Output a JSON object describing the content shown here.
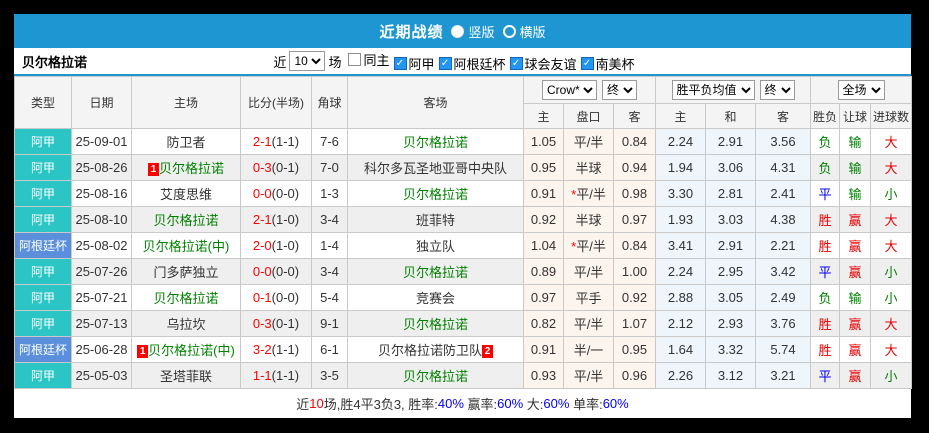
{
  "colors": {
    "accent": "#1e96d2",
    "league_cyan": "#2cc5c5",
    "league_blue": "#5a8fdc",
    "win": "#e60000",
    "loss": "#008000",
    "draw": "#0000f0",
    "score": "#ff0000",
    "team_green": "#008000",
    "link_blue": "#0000f0"
  },
  "title_bar": {
    "title": "近期战绩",
    "layout_options": [
      {
        "label": "竖版",
        "selected": true
      },
      {
        "label": "横版",
        "selected": false
      }
    ]
  },
  "filter_bar": {
    "team": "贝尔格拉诺",
    "near_label": "近",
    "matches_value": "10",
    "matches_label": "场",
    "checkboxes": [
      {
        "label": "同主",
        "checked": false
      },
      {
        "label": "阿甲",
        "checked": true
      },
      {
        "label": "阿根廷杯",
        "checked": true
      },
      {
        "label": "球会友谊",
        "checked": true
      },
      {
        "label": "南美杯",
        "checked": true
      }
    ]
  },
  "table": {
    "columns": [
      "类型",
      "日期",
      "主场",
      "比分(半场)",
      "角球",
      "客场"
    ],
    "odds_group": {
      "book_select": "Crow*",
      "period_select": "终"
    },
    "mean_group": {
      "label_select": "胜平负均值",
      "period_select": "终"
    },
    "scope_group": {
      "label_select": "全场"
    },
    "sub_columns": [
      "主",
      "盘口",
      "客",
      "主",
      "和",
      "客",
      "胜负",
      "让球",
      "进球数"
    ],
    "rows": [
      {
        "type": "阿甲",
        "type_color": "cyan",
        "date": "25-09-01",
        "home": {
          "text": "防卫者",
          "green": false,
          "badge": null
        },
        "score": {
          "main": "2-1",
          "half": "(1-1)"
        },
        "corner": "7-6",
        "away": {
          "text": "贝尔格拉诺",
          "green": true,
          "badge": null
        },
        "odds": {
          "home": "1.05",
          "handicap": "平/半",
          "star": false,
          "away": "0.84"
        },
        "means": [
          "2.24",
          "2.91",
          "3.56"
        ],
        "results": [
          {
            "t": "负",
            "c": "g"
          },
          {
            "t": "输",
            "c": "g"
          },
          {
            "t": "大",
            "c": "r"
          }
        ]
      },
      {
        "type": "阿甲",
        "type_color": "cyan",
        "date": "25-08-26",
        "home": {
          "text": "贝尔格拉诺",
          "green": true,
          "badge": "1"
        },
        "score": {
          "main": "0-3",
          "half": "(0-1)"
        },
        "corner": "7-0",
        "away": {
          "text": "科尔多瓦圣地亚哥中央队",
          "green": false,
          "badge": null
        },
        "odds": {
          "home": "0.95",
          "handicap": "半球",
          "star": false,
          "away": "0.94"
        },
        "means": [
          "1.94",
          "3.06",
          "4.31"
        ],
        "results": [
          {
            "t": "负",
            "c": "g"
          },
          {
            "t": "输",
            "c": "g"
          },
          {
            "t": "大",
            "c": "r"
          }
        ]
      },
      {
        "type": "阿甲",
        "type_color": "cyan",
        "date": "25-08-16",
        "home": {
          "text": "艾度思维",
          "green": false,
          "badge": null
        },
        "score": {
          "main": "0-0",
          "half": "(0-0)"
        },
        "corner": "1-3",
        "away": {
          "text": "贝尔格拉诺",
          "green": true,
          "badge": null
        },
        "odds": {
          "home": "0.91",
          "handicap": "平/半",
          "star": true,
          "away": "0.98"
        },
        "means": [
          "3.30",
          "2.81",
          "2.41"
        ],
        "results": [
          {
            "t": "平",
            "c": "b"
          },
          {
            "t": "输",
            "c": "g"
          },
          {
            "t": "小",
            "c": "g"
          }
        ]
      },
      {
        "type": "阿甲",
        "type_color": "cyan",
        "date": "25-08-10",
        "home": {
          "text": "贝尔格拉诺",
          "green": true,
          "badge": null
        },
        "score": {
          "main": "2-1",
          "half": "(1-0)"
        },
        "corner": "3-4",
        "away": {
          "text": "班菲特",
          "green": false,
          "badge": null
        },
        "odds": {
          "home": "0.92",
          "handicap": "半球",
          "star": false,
          "away": "0.97"
        },
        "means": [
          "1.93",
          "3.03",
          "4.38"
        ],
        "results": [
          {
            "t": "胜",
            "c": "r"
          },
          {
            "t": "赢",
            "c": "r"
          },
          {
            "t": "大",
            "c": "r"
          }
        ]
      },
      {
        "type": "阿根廷杯",
        "type_color": "blue",
        "date": "25-08-02",
        "home": {
          "text": "贝尔格拉诺(中)",
          "green": true,
          "badge": null
        },
        "score": {
          "main": "2-0",
          "half": "(1-0)"
        },
        "corner": "1-4",
        "away": {
          "text": "独立队",
          "green": false,
          "badge": null
        },
        "odds": {
          "home": "1.04",
          "handicap": "平/半",
          "star": true,
          "away": "0.84"
        },
        "means": [
          "3.41",
          "2.91",
          "2.21"
        ],
        "results": [
          {
            "t": "胜",
            "c": "r"
          },
          {
            "t": "赢",
            "c": "r"
          },
          {
            "t": "大",
            "c": "r"
          }
        ]
      },
      {
        "type": "阿甲",
        "type_color": "cyan",
        "date": "25-07-26",
        "home": {
          "text": "门多萨独立",
          "green": false,
          "badge": null
        },
        "score": {
          "main": "0-0",
          "half": "(0-0)"
        },
        "corner": "3-4",
        "away": {
          "text": "贝尔格拉诺",
          "green": true,
          "badge": null
        },
        "odds": {
          "home": "0.89",
          "handicap": "平/半",
          "star": false,
          "away": "1.00"
        },
        "means": [
          "2.24",
          "2.95",
          "3.42"
        ],
        "results": [
          {
            "t": "平",
            "c": "b"
          },
          {
            "t": "赢",
            "c": "r"
          },
          {
            "t": "小",
            "c": "g"
          }
        ]
      },
      {
        "type": "阿甲",
        "type_color": "cyan",
        "date": "25-07-21",
        "home": {
          "text": "贝尔格拉诺",
          "green": true,
          "badge": null
        },
        "score": {
          "main": "0-1",
          "half": "(0-0)"
        },
        "corner": "5-4",
        "away": {
          "text": "竞赛会",
          "green": false,
          "badge": null
        },
        "odds": {
          "home": "0.97",
          "handicap": "平手",
          "star": false,
          "away": "0.92"
        },
        "means": [
          "2.88",
          "3.05",
          "2.49"
        ],
        "results": [
          {
            "t": "负",
            "c": "g"
          },
          {
            "t": "输",
            "c": "g"
          },
          {
            "t": "小",
            "c": "g"
          }
        ]
      },
      {
        "type": "阿甲",
        "type_color": "cyan",
        "date": "25-07-13",
        "home": {
          "text": "乌拉坎",
          "green": false,
          "badge": null
        },
        "score": {
          "main": "0-3",
          "half": "(0-1)"
        },
        "corner": "9-1",
        "away": {
          "text": "贝尔格拉诺",
          "green": true,
          "badge": null
        },
        "odds": {
          "home": "0.82",
          "handicap": "平/半",
          "star": false,
          "away": "1.07"
        },
        "means": [
          "2.12",
          "2.93",
          "3.76"
        ],
        "results": [
          {
            "t": "胜",
            "c": "r"
          },
          {
            "t": "赢",
            "c": "r"
          },
          {
            "t": "大",
            "c": "r"
          }
        ]
      },
      {
        "type": "阿根廷杯",
        "type_color": "blue",
        "date": "25-06-28",
        "home": {
          "text": "贝尔格拉诺(中)",
          "green": true,
          "badge": "1"
        },
        "score": {
          "main": "3-2",
          "half": "(1-1)"
        },
        "corner": "6-1",
        "away": {
          "text": "贝尔格拉诺防卫队",
          "green": false,
          "badge": "2"
        },
        "odds": {
          "home": "0.91",
          "handicap": "半/一",
          "star": false,
          "away": "0.95"
        },
        "means": [
          "1.64",
          "3.32",
          "5.74"
        ],
        "results": [
          {
            "t": "胜",
            "c": "r"
          },
          {
            "t": "赢",
            "c": "r"
          },
          {
            "t": "大",
            "c": "r"
          }
        ]
      },
      {
        "type": "阿甲",
        "type_color": "cyan",
        "date": "25-05-03",
        "home": {
          "text": "圣塔菲联",
          "green": false,
          "badge": null
        },
        "score": {
          "main": "1-1",
          "half": "(1-1)"
        },
        "corner": "3-5",
        "away": {
          "text": "贝尔格拉诺",
          "green": true,
          "badge": null
        },
        "odds": {
          "home": "0.93",
          "handicap": "平/半",
          "star": false,
          "away": "0.96"
        },
        "means": [
          "2.26",
          "3.12",
          "3.21"
        ],
        "results": [
          {
            "t": "平",
            "c": "b"
          },
          {
            "t": "赢",
            "c": "r"
          },
          {
            "t": "小",
            "c": "g"
          }
        ]
      }
    ]
  },
  "footer": {
    "segments": [
      {
        "t": "近",
        "c": "#333333"
      },
      {
        "t": "10",
        "c": "#ff0000"
      },
      {
        "t": "场,胜4平3负3, 胜率:",
        "c": "#333333"
      },
      {
        "t": "40%",
        "c": "#0000f0"
      },
      {
        "t": " 赢率:",
        "c": "#333333"
      },
      {
        "t": "60%",
        "c": "#0000f0"
      },
      {
        "t": " 大:",
        "c": "#333333"
      },
      {
        "t": "60%",
        "c": "#0000f0"
      },
      {
        "t": " 单率:",
        "c": "#333333"
      },
      {
        "t": "60%",
        "c": "#0000f0"
      }
    ]
  }
}
